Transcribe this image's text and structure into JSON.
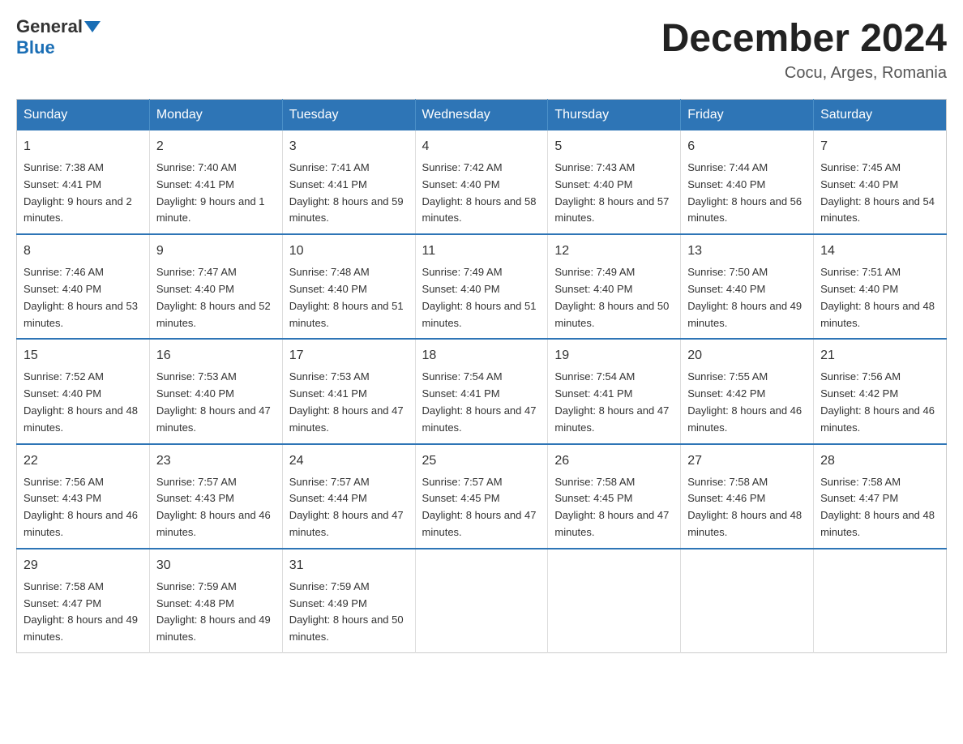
{
  "header": {
    "logo_general": "General",
    "logo_blue": "Blue",
    "main_title": "December 2024",
    "subtitle": "Cocu, Arges, Romania"
  },
  "days_of_week": [
    "Sunday",
    "Monday",
    "Tuesday",
    "Wednesday",
    "Thursday",
    "Friday",
    "Saturday"
  ],
  "weeks": [
    [
      {
        "day": "1",
        "sunrise": "7:38 AM",
        "sunset": "4:41 PM",
        "daylight": "9 hours and 2 minutes."
      },
      {
        "day": "2",
        "sunrise": "7:40 AM",
        "sunset": "4:41 PM",
        "daylight": "9 hours and 1 minute."
      },
      {
        "day": "3",
        "sunrise": "7:41 AM",
        "sunset": "4:41 PM",
        "daylight": "8 hours and 59 minutes."
      },
      {
        "day": "4",
        "sunrise": "7:42 AM",
        "sunset": "4:40 PM",
        "daylight": "8 hours and 58 minutes."
      },
      {
        "day": "5",
        "sunrise": "7:43 AM",
        "sunset": "4:40 PM",
        "daylight": "8 hours and 57 minutes."
      },
      {
        "day": "6",
        "sunrise": "7:44 AM",
        "sunset": "4:40 PM",
        "daylight": "8 hours and 56 minutes."
      },
      {
        "day": "7",
        "sunrise": "7:45 AM",
        "sunset": "4:40 PM",
        "daylight": "8 hours and 54 minutes."
      }
    ],
    [
      {
        "day": "8",
        "sunrise": "7:46 AM",
        "sunset": "4:40 PM",
        "daylight": "8 hours and 53 minutes."
      },
      {
        "day": "9",
        "sunrise": "7:47 AM",
        "sunset": "4:40 PM",
        "daylight": "8 hours and 52 minutes."
      },
      {
        "day": "10",
        "sunrise": "7:48 AM",
        "sunset": "4:40 PM",
        "daylight": "8 hours and 51 minutes."
      },
      {
        "day": "11",
        "sunrise": "7:49 AM",
        "sunset": "4:40 PM",
        "daylight": "8 hours and 51 minutes."
      },
      {
        "day": "12",
        "sunrise": "7:49 AM",
        "sunset": "4:40 PM",
        "daylight": "8 hours and 50 minutes."
      },
      {
        "day": "13",
        "sunrise": "7:50 AM",
        "sunset": "4:40 PM",
        "daylight": "8 hours and 49 minutes."
      },
      {
        "day": "14",
        "sunrise": "7:51 AM",
        "sunset": "4:40 PM",
        "daylight": "8 hours and 48 minutes."
      }
    ],
    [
      {
        "day": "15",
        "sunrise": "7:52 AM",
        "sunset": "4:40 PM",
        "daylight": "8 hours and 48 minutes."
      },
      {
        "day": "16",
        "sunrise": "7:53 AM",
        "sunset": "4:40 PM",
        "daylight": "8 hours and 47 minutes."
      },
      {
        "day": "17",
        "sunrise": "7:53 AM",
        "sunset": "4:41 PM",
        "daylight": "8 hours and 47 minutes."
      },
      {
        "day": "18",
        "sunrise": "7:54 AM",
        "sunset": "4:41 PM",
        "daylight": "8 hours and 47 minutes."
      },
      {
        "day": "19",
        "sunrise": "7:54 AM",
        "sunset": "4:41 PM",
        "daylight": "8 hours and 47 minutes."
      },
      {
        "day": "20",
        "sunrise": "7:55 AM",
        "sunset": "4:42 PM",
        "daylight": "8 hours and 46 minutes."
      },
      {
        "day": "21",
        "sunrise": "7:56 AM",
        "sunset": "4:42 PM",
        "daylight": "8 hours and 46 minutes."
      }
    ],
    [
      {
        "day": "22",
        "sunrise": "7:56 AM",
        "sunset": "4:43 PM",
        "daylight": "8 hours and 46 minutes."
      },
      {
        "day": "23",
        "sunrise": "7:57 AM",
        "sunset": "4:43 PM",
        "daylight": "8 hours and 46 minutes."
      },
      {
        "day": "24",
        "sunrise": "7:57 AM",
        "sunset": "4:44 PM",
        "daylight": "8 hours and 47 minutes."
      },
      {
        "day": "25",
        "sunrise": "7:57 AM",
        "sunset": "4:45 PM",
        "daylight": "8 hours and 47 minutes."
      },
      {
        "day": "26",
        "sunrise": "7:58 AM",
        "sunset": "4:45 PM",
        "daylight": "8 hours and 47 minutes."
      },
      {
        "day": "27",
        "sunrise": "7:58 AM",
        "sunset": "4:46 PM",
        "daylight": "8 hours and 48 minutes."
      },
      {
        "day": "28",
        "sunrise": "7:58 AM",
        "sunset": "4:47 PM",
        "daylight": "8 hours and 48 minutes."
      }
    ],
    [
      {
        "day": "29",
        "sunrise": "7:58 AM",
        "sunset": "4:47 PM",
        "daylight": "8 hours and 49 minutes."
      },
      {
        "day": "30",
        "sunrise": "7:59 AM",
        "sunset": "4:48 PM",
        "daylight": "8 hours and 49 minutes."
      },
      {
        "day": "31",
        "sunrise": "7:59 AM",
        "sunset": "4:49 PM",
        "daylight": "8 hours and 50 minutes."
      },
      null,
      null,
      null,
      null
    ]
  ],
  "labels": {
    "sunrise_prefix": "Sunrise: ",
    "sunset_prefix": "Sunset: ",
    "daylight_prefix": "Daylight: "
  }
}
